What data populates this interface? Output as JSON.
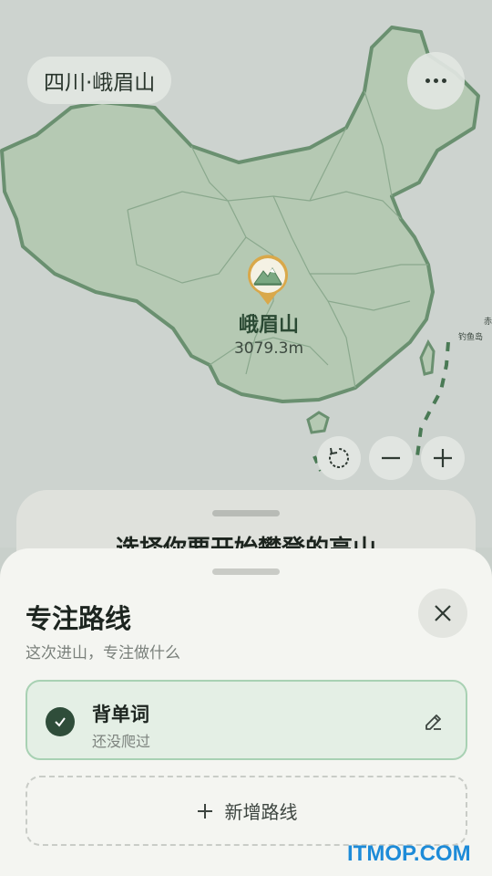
{
  "header": {
    "location": "四川·峨眉山",
    "more_icon": "more-dots-icon"
  },
  "map": {
    "peak_name": "峨眉山",
    "peak_altitude": "3079.3m",
    "islet_label": "钓鱼岛",
    "islet_label_partial": "赤",
    "controls": [
      "refresh-icon",
      "zoom-out-icon",
      "zoom-in-icon"
    ]
  },
  "under_sheet": {
    "title": "选择你要开始攀登的高山"
  },
  "sheet": {
    "title": "专注路线",
    "subtitle": "这次进山，专注做什么",
    "close_icon": "close-icon",
    "routes": [
      {
        "name": "背单词",
        "status": "还没爬过",
        "selected": true
      }
    ],
    "add_label": "新增路线"
  },
  "watermark": "ITMOP.COM",
  "colors": {
    "accent": "#2f4d3a",
    "card_border": "#a8d1b3",
    "card_bg": "#e4efe5",
    "map_land": "#b5c9b3",
    "map_border": "#6a9070",
    "pin": "#d9a84a"
  }
}
